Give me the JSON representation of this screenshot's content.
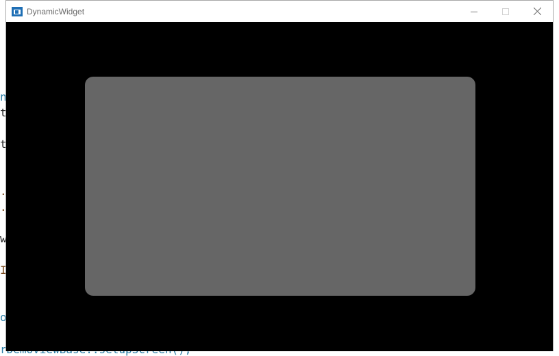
{
  "window": {
    "title": "DynamicWidget",
    "controls": {
      "minimize_icon": "minimize-icon",
      "maximize_icon": "maximize-icon",
      "close_icon": "close-icon"
    }
  },
  "background_code": [
    "nc",
    "t",
    "t",
    ".i",
    ".i",
    "w",
    "I",
    "o",
    "rDemoViewBase::setupScreen();"
  ],
  "colors": {
    "client_background": "#000000",
    "panel": "#666666",
    "title_text": "#6b6b6b"
  }
}
